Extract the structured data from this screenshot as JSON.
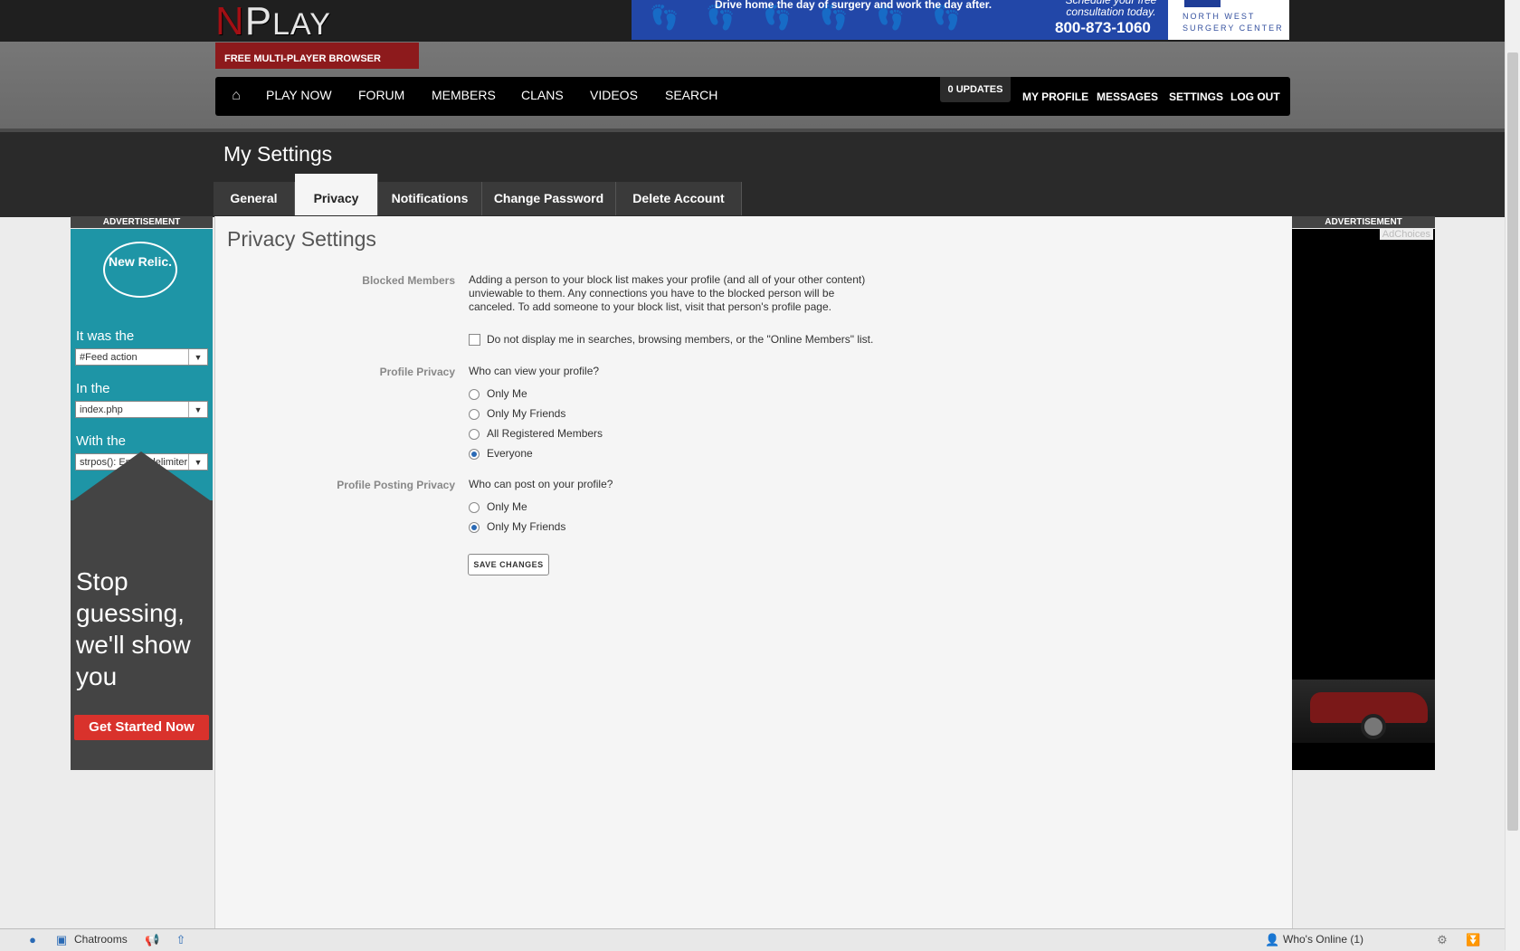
{
  "header": {
    "logo_n": "N",
    "logo_p": "P",
    "logo_rest": "LAY",
    "tagline": "FREE MULTI-PLAYER BROWSER GAMES",
    "banner": {
      "tagline": "Drive home the day of surgery and work the day after.",
      "consult": "Schedule your free consultation today.",
      "phone": "800-873-1060",
      "brand_line1": "NORTH WEST",
      "brand_line2": "SURGERY CENTER"
    }
  },
  "nav": {
    "home_icon": "home-icon",
    "items": [
      "PLAY NOW",
      "FORUM",
      "MEMBERS",
      "CLANS",
      "VIDEOS",
      "SEARCH"
    ],
    "updates": "0 UPDATES",
    "right": [
      "MY PROFILE",
      "MESSAGES",
      "SETTINGS",
      "LOG OUT"
    ]
  },
  "settings": {
    "title": "My Settings",
    "tabs": [
      "General",
      "Privacy",
      "Notifications",
      "Change Password",
      "Delete Account"
    ],
    "active_tab": "Privacy"
  },
  "privacy": {
    "section_title": "Privacy Settings",
    "blocked": {
      "label": "Blocked Members",
      "description": "Adding a person to your block list makes your profile (and all of your other content) unviewable to them. Any connections you have to the blocked person will be canceled. To add someone to your block list, visit that person's profile page.",
      "checkbox_label": "Do not display me in searches, browsing members, or the \"Online Members\" list.",
      "checked": false
    },
    "profile": {
      "label": "Profile Privacy",
      "question": "Who can view your profile?",
      "options": [
        "Only Me",
        "Only My Friends",
        "All Registered Members",
        "Everyone"
      ],
      "selected": "Everyone"
    },
    "posting": {
      "label": "Profile Posting Privacy",
      "question": "Who can post on your profile?",
      "options": [
        "Only Me",
        "Only My Friends"
      ],
      "selected": "Only My Friends"
    },
    "save_label": "SAVE CHANGES"
  },
  "ads": {
    "label": "ADVERTISEMENT",
    "left": {
      "logo": "New Relic.",
      "line1": "It was the",
      "select1": "#Feed action",
      "line2": "In the",
      "select2": "index.php",
      "line3": "With the",
      "select3": "strpos(): Empty delimiter",
      "headline": "Stop guessing, we'll show you",
      "cta": "Get Started Now"
    },
    "right": {
      "adchoices": "AdChoices"
    }
  },
  "bottombar": {
    "chatrooms": "Chatrooms",
    "whos_online": "Who's Online (1)"
  },
  "colors": {
    "brand_red": "#8d1a1c",
    "radio_selected": "#2a6ab5",
    "ad_teal": "#1e95a6",
    "cta_red": "#d9322c"
  }
}
